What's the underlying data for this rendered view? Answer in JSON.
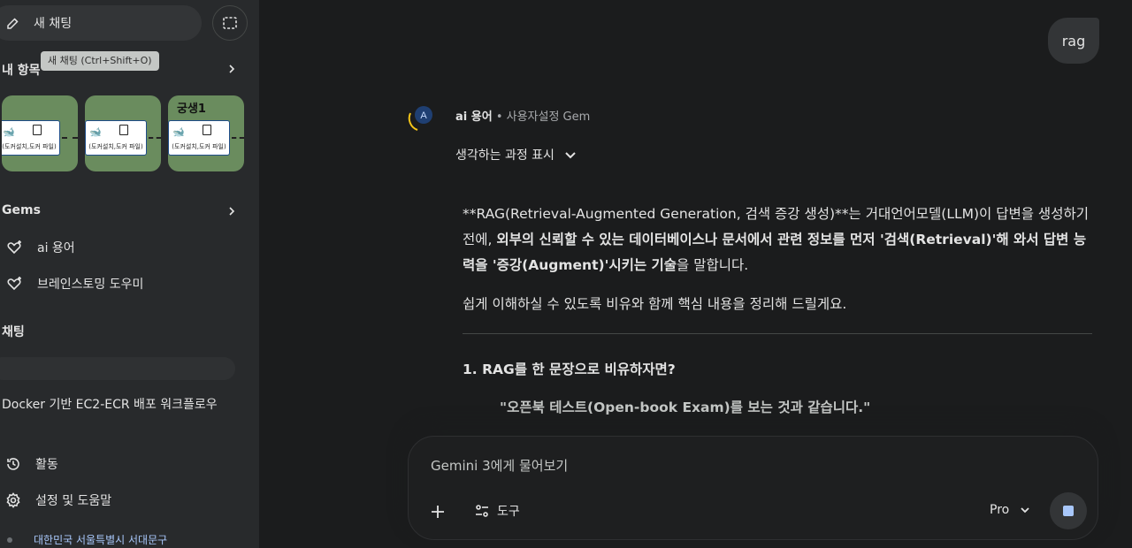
{
  "sidebar": {
    "new_chat_label": "새 채팅",
    "tooltip": "새 채팅 (Ctrl+Shift+O)",
    "my_items_title": "내 항목",
    "thumbnails": [
      {
        "title": "",
        "card_text": "(도커설치,도커 파일)"
      },
      {
        "title": "",
        "card_text": "(도커설치,도커 파일)"
      },
      {
        "title": "궁생1",
        "card_text": "(도커설치,도커 파일)"
      }
    ],
    "gems_title": "Gems",
    "gems": [
      {
        "label": "ai 용어"
      },
      {
        "label": "브레인스토밍 도우미"
      }
    ],
    "chats_title": "채팅",
    "chats": [
      {
        "label": "Docker 기반 EC2-ECR 배포 워크플로우"
      }
    ],
    "activity_label": "활동",
    "settings_label": "설정 및 도움말",
    "location": "대한민국 서울특별시 서대문구"
  },
  "conversation": {
    "user_message": "rag",
    "avatar_letter": "A",
    "gem_name": "ai 용어",
    "gem_suffix": " • 사용자설정 Gem",
    "thinking_label": "생각하는 과정 표시",
    "p1_a": "**RAG(Retrieval-Augmented Generation, 검색 증강 생성)**는 거대언어모델(LLM)이 답변을 생성하기 전에, ",
    "p1_b": "외부의 신뢰할 수 있는 데이터베이스나 문서에서 관련 정보를 먼저 '검색(Retrieval)'해 와서 답변 능력을 '증강(Augment)'시키는 기술",
    "p1_c": "을 말합니다.",
    "p2": "쉽게 이해하실 수 있도록 비유와 함께 핵심 내용을 정리해 드릴게요.",
    "h1": "1. RAG를 한 문장으로 비유하자면?",
    "quote": "\"오픈북 테스트(Open-book Exam)를 보는 것과 같습니다.\""
  },
  "input": {
    "placeholder": "Gemini 3에게 물어보기",
    "tools_label": "도구",
    "model_label": "Pro"
  },
  "colors": {
    "background": "#1b1c1d",
    "sidebar": "#282a2c",
    "accent": "#a8c7fa",
    "avatar": "#1f3f72"
  }
}
